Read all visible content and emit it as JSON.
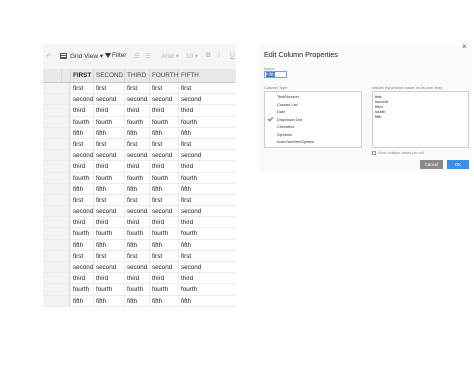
{
  "toolbar": {
    "view_label": "Grid View",
    "filter_label": "Filter",
    "arial_label": "Arial",
    "size_label": "10",
    "bold_label": "B",
    "italic_label": "I",
    "underline_label": "U"
  },
  "grid": {
    "columns": [
      "FIRST",
      "SECOND",
      "THIRD",
      "FOURTH",
      "FIFTH"
    ],
    "rows": [
      [
        "first",
        "first",
        "first",
        "first",
        "first"
      ],
      [
        "second",
        "second",
        "second",
        "second",
        "second"
      ],
      [
        "third",
        "third",
        "third",
        "third",
        "third"
      ],
      [
        "fourth",
        "fourth",
        "fourth",
        "fourth",
        "fourth"
      ],
      [
        "fifth",
        "fifth",
        "fifth",
        "fifth",
        "fifth"
      ],
      [
        "first",
        "first",
        "first",
        "first",
        "first"
      ],
      [
        "second",
        "second",
        "second",
        "second",
        "second"
      ],
      [
        "third",
        "third",
        "third",
        "third",
        "third"
      ],
      [
        "fourth",
        "fourth",
        "fourth",
        "fourth",
        "fourth"
      ],
      [
        "fifth",
        "fifth",
        "fifth",
        "fifth",
        "fifth"
      ],
      [
        "first",
        "first",
        "first",
        "first",
        "first"
      ],
      [
        "second",
        "second",
        "second",
        "second",
        "second"
      ],
      [
        "third",
        "third",
        "third",
        "third",
        "third"
      ],
      [
        "fourth",
        "fourth",
        "fourth",
        "fourth",
        "fourth"
      ],
      [
        "fifth",
        "fifth",
        "fifth",
        "fifth",
        "fifth"
      ],
      [
        "first",
        "first",
        "first",
        "first",
        "first"
      ],
      [
        "second",
        "second",
        "second",
        "second",
        "second"
      ],
      [
        "third",
        "third",
        "third",
        "third",
        "third"
      ],
      [
        "fourth",
        "fourth",
        "fourth",
        "fourth",
        "fourth"
      ],
      [
        "fifth",
        "fifth",
        "fifth",
        "fifth",
        "fifth"
      ]
    ]
  },
  "dialog": {
    "title": "Edit Column Properties",
    "close": "×",
    "name_label": "Name",
    "name_value": "Fifth",
    "type_label": "Column Type",
    "column_types": [
      "Text/Number",
      "Contact List",
      "Date",
      "Dropdown List",
      "Checkbox",
      "Symbols",
      "Auto-Number/System"
    ],
    "selected_type_index": 3,
    "values_label": "Values (type each value on its own line)",
    "values": [
      "first",
      "second",
      "third",
      "fourth",
      "fifth"
    ],
    "multi_label": "Allow multiple values per cell",
    "cancel_label": "Cancel",
    "ok_label": "OK"
  }
}
